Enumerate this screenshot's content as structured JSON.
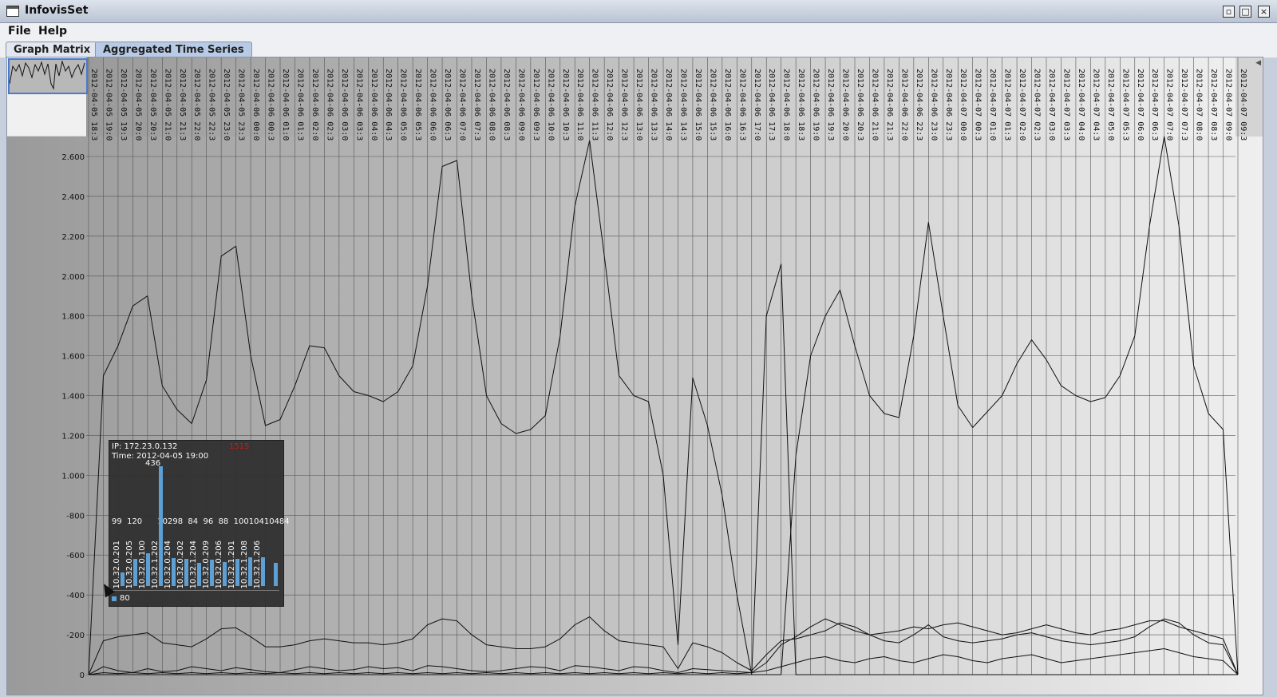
{
  "window": {
    "title": "InfovisSet"
  },
  "menu": {
    "items": [
      "File",
      "Help"
    ]
  },
  "tabs": [
    {
      "label": "Graph Matrix",
      "active": false
    },
    {
      "label": "Aggregated Time Series",
      "active": true
    }
  ],
  "colors": {
    "tooltip_bar": "#5aa0d8",
    "highlight_red": "#d01010",
    "selection_border": "#4a7ad0"
  },
  "chart_data": {
    "type": "line",
    "x_ticks": [
      "2012-04-05 18:3",
      "2012-04-05 19:0",
      "2012-04-05 19:3",
      "2012-04-05 20:0",
      "2012-04-05 20:3",
      "2012-04-05 21:0",
      "2012-04-05 21:3",
      "2012-04-05 22:0",
      "2012-04-05 22:3",
      "2012-04-05 23:0",
      "2012-04-05 23:3",
      "2012-04-06 00:0",
      "2012-04-06 00:3",
      "2012-04-06 01:0",
      "2012-04-06 01:3",
      "2012-04-06 02:0",
      "2012-04-06 02:3",
      "2012-04-06 03:0",
      "2012-04-06 03:3",
      "2012-04-06 04:0",
      "2012-04-06 04:3",
      "2012-04-06 05:0",
      "2012-04-06 05:3",
      "2012-04-06 06:0",
      "2012-04-06 06:3",
      "2012-04-06 07:0",
      "2012-04-06 07:3",
      "2012-04-06 08:0",
      "2012-04-06 08:3",
      "2012-04-06 09:0",
      "2012-04-06 09:3",
      "2012-04-06 10:0",
      "2012-04-06 10:3",
      "2012-04-06 11:0",
      "2012-04-06 11:3",
      "2012-04-06 12:0",
      "2012-04-06 12:3",
      "2012-04-06 13:0",
      "2012-04-06 13:3",
      "2012-04-06 14:0",
      "2012-04-06 14:3",
      "2012-04-06 15:0",
      "2012-04-06 15:3",
      "2012-04-06 16:0",
      "2012-04-06 16:3",
      "2012-04-06 17:0",
      "2012-04-06 17:3",
      "2012-04-06 18:0",
      "2012-04-06 18:3",
      "2012-04-06 19:0",
      "2012-04-06 19:3",
      "2012-04-06 20:0",
      "2012-04-06 20:3",
      "2012-04-06 21:0",
      "2012-04-06 21:3",
      "2012-04-06 22:0",
      "2012-04-06 22:3",
      "2012-04-06 23:0",
      "2012-04-06 23:3",
      "2012-04-07 00:0",
      "2012-04-07 00:3",
      "2012-04-07 01:0",
      "2012-04-07 01:3",
      "2012-04-07 02:0",
      "2012-04-07 02:3",
      "2012-04-07 03:0",
      "2012-04-07 03:3",
      "2012-04-07 04:0",
      "2012-04-07 04:3",
      "2012-04-07 05:0",
      "2012-04-07 05:3",
      "2012-04-07 06:0",
      "2012-04-07 06:3",
      "2012-04-07 07:0",
      "2012-04-07 07:3",
      "2012-04-07 08:0",
      "2012-04-07 08:3",
      "2012-04-07 09:0",
      "2012-04-07 09:3"
    ],
    "y_ticks": [
      "2.600",
      "2.400",
      "2.200",
      "2.000",
      "1.800",
      "1.600",
      "1.400",
      "1.200",
      "1.000",
      "-800",
      "-600",
      "-400",
      "-200",
      "0"
    ],
    "ylim": [
      0,
      2600
    ],
    "grid": true,
    "series": [
      {
        "values": [
          0,
          1500,
          1650,
          1850,
          1900,
          1450,
          1330,
          1260,
          1480,
          2100,
          2150,
          1600,
          1250,
          1280,
          1450,
          1650,
          1640,
          1500,
          1420,
          1400,
          1370,
          1420,
          1550,
          1950,
          2550,
          2580,
          1900,
          1400,
          1260,
          1210,
          1230,
          1300,
          1700,
          2350,
          2680,
          2100,
          1500,
          1400,
          1370,
          1000,
          150,
          1490,
          1250,
          900,
          400,
          0,
          1800,
          2060,
          0,
          0,
          0,
          0,
          0,
          0,
          0,
          0,
          0,
          0,
          0,
          0,
          0,
          0,
          0,
          0,
          0,
          0,
          0,
          0,
          0,
          0,
          0,
          0,
          0,
          0,
          0,
          0,
          0,
          0,
          0
        ]
      },
      {
        "values": [
          0,
          0,
          0,
          0,
          0,
          0,
          0,
          0,
          0,
          0,
          0,
          0,
          0,
          0,
          0,
          0,
          0,
          0,
          0,
          0,
          0,
          0,
          0,
          0,
          0,
          0,
          0,
          0,
          0,
          0,
          0,
          0,
          0,
          0,
          0,
          0,
          0,
          0,
          0,
          0,
          0,
          0,
          0,
          0,
          0,
          0,
          0,
          0,
          1100,
          1600,
          1800,
          1930,
          1650,
          1400,
          1310,
          1290,
          1700,
          2270,
          1800,
          1350,
          1240,
          1320,
          1400,
          1560,
          1680,
          1580,
          1450,
          1400,
          1370,
          1390,
          1500,
          1700,
          2250,
          2700,
          2250,
          1550,
          1310,
          1230,
          0
        ]
      },
      {
        "values": [
          0,
          170,
          190,
          200,
          210,
          160,
          150,
          140,
          180,
          230,
          235,
          190,
          140,
          140,
          150,
          170,
          180,
          170,
          160,
          160,
          150,
          160,
          180,
          250,
          280,
          270,
          200,
          150,
          140,
          130,
          130,
          140,
          180,
          250,
          290,
          220,
          170,
          160,
          150,
          140,
          30,
          160,
          140,
          110,
          60,
          20,
          100,
          170,
          180,
          200,
          220,
          260,
          240,
          200,
          170,
          160,
          200,
          250,
          190,
          170,
          160,
          170,
          180,
          200,
          210,
          190,
          170,
          160,
          150,
          160,
          170,
          190,
          240,
          280,
          260,
          200,
          160,
          150,
          0
        ]
      },
      {
        "values": [
          0,
          40,
          20,
          10,
          30,
          15,
          20,
          40,
          30,
          20,
          35,
          25,
          15,
          10,
          25,
          40,
          30,
          20,
          25,
          40,
          30,
          35,
          20,
          45,
          40,
          30,
          20,
          15,
          20,
          30,
          40,
          35,
          20,
          45,
          40,
          30,
          20,
          40,
          35,
          20,
          10,
          30,
          25,
          20,
          15,
          10,
          60,
          150,
          190,
          240,
          280,
          250,
          220,
          200,
          210,
          220,
          240,
          230,
          250,
          260,
          240,
          220,
          200,
          210,
          230,
          250,
          230,
          210,
          200,
          220,
          230,
          250,
          270,
          270,
          240,
          220,
          200,
          180,
          0
        ]
      },
      {
        "values": [
          0,
          10,
          5,
          10,
          5,
          10,
          5,
          10,
          5,
          10,
          5,
          10,
          5,
          10,
          5,
          10,
          5,
          10,
          5,
          10,
          5,
          10,
          5,
          10,
          5,
          10,
          5,
          10,
          5,
          10,
          5,
          10,
          5,
          10,
          5,
          10,
          5,
          10,
          5,
          10,
          5,
          10,
          5,
          10,
          5,
          10,
          20,
          40,
          60,
          80,
          90,
          70,
          60,
          80,
          90,
          70,
          60,
          80,
          100,
          90,
          70,
          60,
          80,
          90,
          100,
          80,
          60,
          70,
          80,
          90,
          100,
          110,
          120,
          130,
          110,
          90,
          80,
          70,
          0
        ]
      }
    ]
  },
  "tooltip": {
    "ip_line": "IP: 172.23.0.132",
    "time_line": "Time: 2012-04-05 19:00",
    "highlight": "1515",
    "peak_value": "436",
    "values_row": "99  120      10298  84  96  88  10010410484",
    "bars": [
      {
        "label": "10.32.0.201",
        "value": 50
      },
      {
        "label": "10.32.0.205",
        "value": 99
      },
      {
        "label": "10.32.0.100",
        "value": 120
      },
      {
        "label": "10.32.1.202",
        "value": 436
      },
      {
        "label": "10.32.0.204",
        "value": 102
      },
      {
        "label": "10.32.0.202",
        "value": 98
      },
      {
        "label": "10.32.1.204",
        "value": 84
      },
      {
        "label": "10.32.0.209",
        "value": 96
      },
      {
        "label": "10.32.0.206",
        "value": 88
      },
      {
        "label": "10.32.1.201",
        "value": 100
      },
      {
        "label": "10.32.1.208",
        "value": 104
      },
      {
        "label": "10.32.1.206",
        "value": 104
      },
      {
        "label": "",
        "value": 84
      }
    ],
    "legend": "80"
  }
}
